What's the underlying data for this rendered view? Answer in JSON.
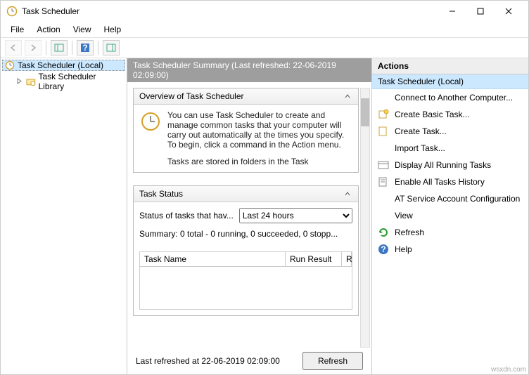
{
  "window": {
    "title": "Task Scheduler"
  },
  "menu": {
    "file": "File",
    "action": "Action",
    "view": "View",
    "help": "Help"
  },
  "tree": {
    "root": "Task Scheduler (Local)",
    "child": "Task Scheduler Library"
  },
  "center": {
    "header": "Task Scheduler Summary (Last refreshed: 22-06-2019 02:09:00)",
    "overview_title": "Overview of Task Scheduler",
    "overview_text1": "You can use Task Scheduler to create and manage common tasks that your computer will carry out automatically at the times you specify. To begin, click a command in the Action menu.",
    "overview_text2": "Tasks are stored in folders in the Task",
    "status_title": "Task Status",
    "status_label": "Status of tasks that hav...",
    "status_period": "Last 24 hours",
    "summary_line": "Summary: 0 total - 0 running, 0 succeeded, 0 stopp...",
    "col_name": "Task Name",
    "col_result": "Run Result",
    "col_r": "R",
    "footer_text": "Last refreshed at 22-06-2019 02:09:00",
    "refresh_btn": "Refresh"
  },
  "actions": {
    "header": "Actions",
    "group": "Task Scheduler (Local)",
    "items": [
      "Connect to Another Computer...",
      "Create Basic Task...",
      "Create Task...",
      "Import Task...",
      "Display All Running Tasks",
      "Enable All Tasks History",
      "AT Service Account Configuration",
      "View",
      "Refresh",
      "Help"
    ]
  },
  "watermark": "wsxdn.com"
}
